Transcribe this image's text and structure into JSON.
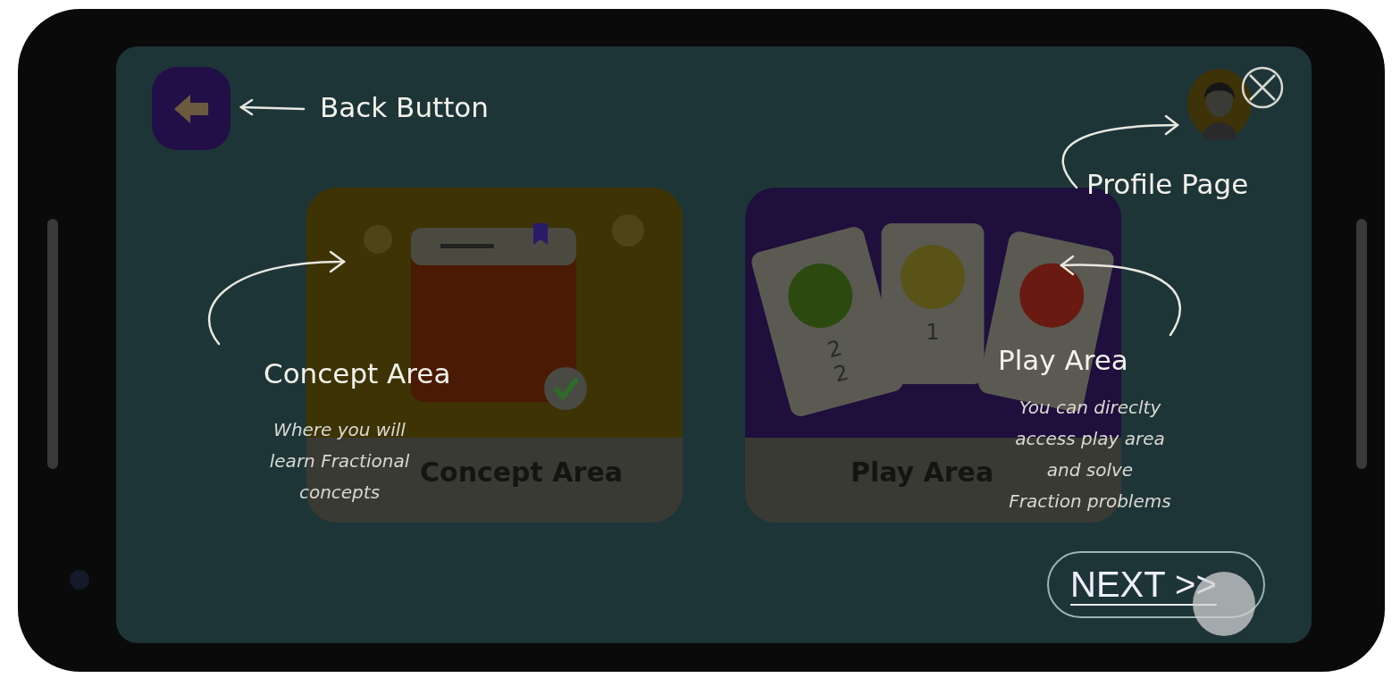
{
  "back_button": {
    "callout": "Back Button"
  },
  "profile": {
    "callout": "Profile Page"
  },
  "cards": [
    {
      "kind": "concept",
      "label": "Concept Area",
      "callout": "Concept Area",
      "description": [
        "Where you will",
        "learn Fractional",
        "concepts"
      ]
    },
    {
      "kind": "play",
      "label": "Play Area",
      "callout": "Play Area",
      "description": [
        "You can direclty",
        "access play area",
        "and solve",
        "Fraction problems"
      ]
    }
  ],
  "play_cards": [
    {
      "numerator": "2",
      "denominator": "2"
    },
    {
      "numerator": "1"
    }
  ],
  "next_button": {
    "label": "NEXT >>"
  }
}
